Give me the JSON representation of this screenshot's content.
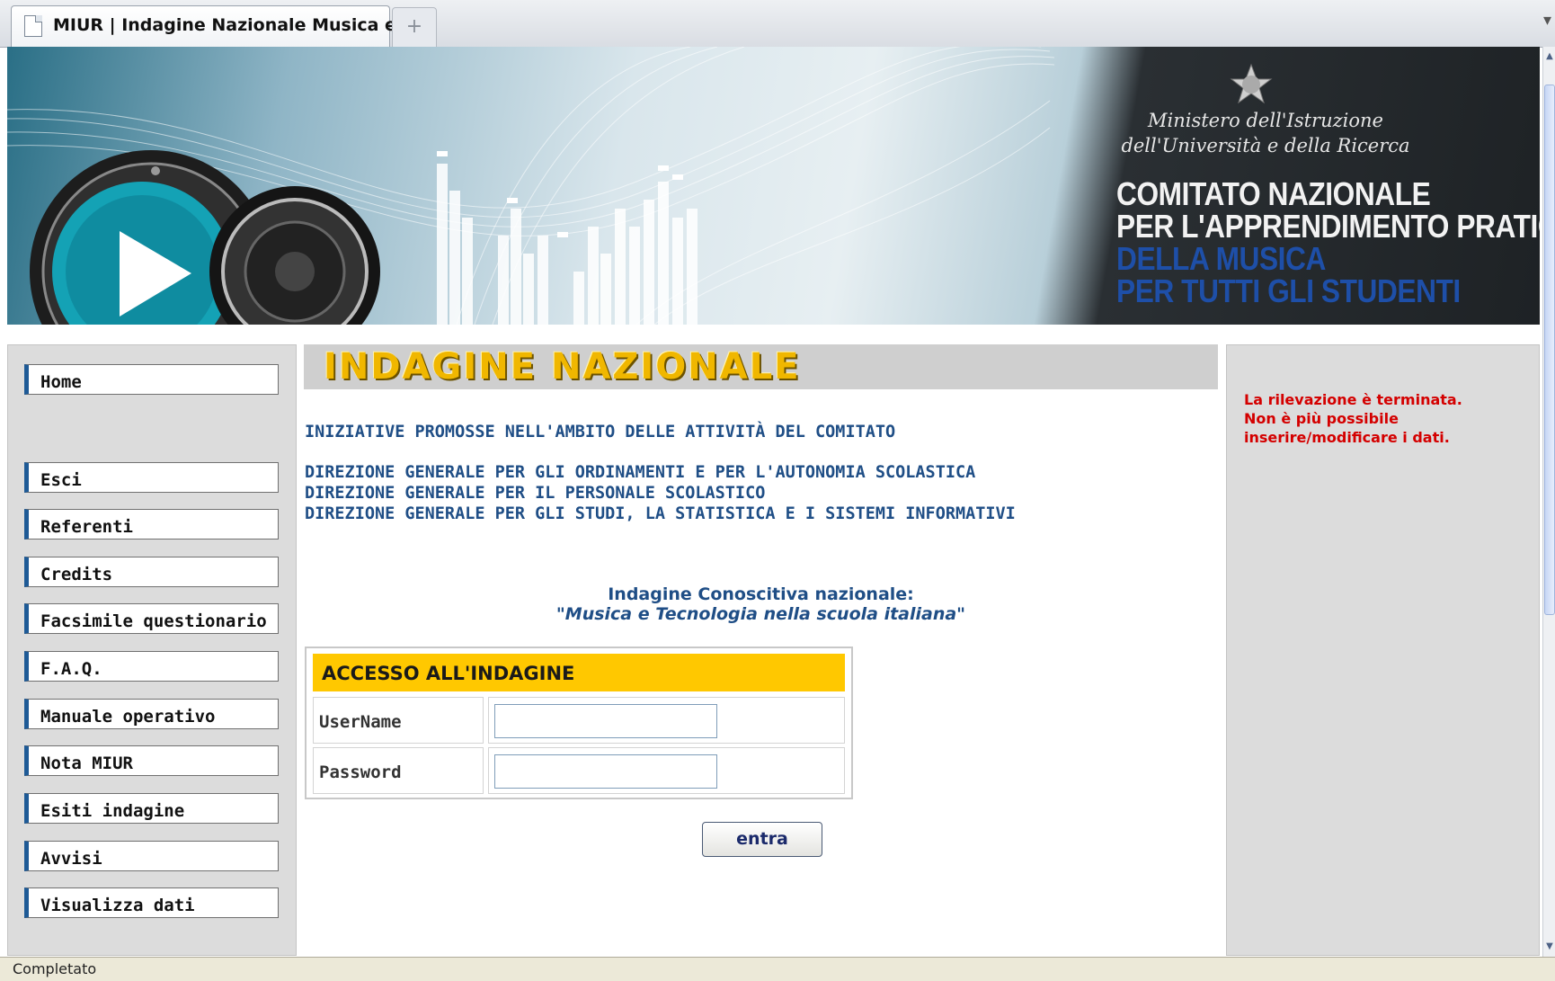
{
  "browser": {
    "tab_title": "MIUR | Indagine Nazionale Musica e ...",
    "new_tab": "+",
    "status": "Completato"
  },
  "banner": {
    "ministry_line1": "Ministero dell'Istruzione",
    "ministry_line2": "dell'Università e della Ricerca",
    "committee": [
      "COMITATO NAZIONALE",
      "PER L'APPRENDIMENTO PRATICO",
      "DELLA MUSICA",
      "PER TUTTI GLI STUDENTI"
    ]
  },
  "nav": {
    "items": [
      "Home",
      "Esci",
      "Referenti",
      "Credits",
      "Facsimile questionario",
      "F.A.Q.",
      "Manuale operativo",
      "Nota MIUR",
      "Esiti indagine",
      "Avvisi",
      "Visualizza dati"
    ]
  },
  "main": {
    "header": "INDAGINE NAZIONALE",
    "initiatives": "INIZIATIVE PROMOSSE NELL'AMBITO DELLE ATTIVITÀ DEL COMITATO",
    "directorates": [
      "DIREZIONE GENERALE PER GLI ORDINAMENTI E PER L'AUTONOMIA SCOLASTICA",
      "DIREZIONE GENERALE PER IL PERSONALE SCOLASTICO",
      "DIREZIONE GENERALE PER GLI STUDI, LA STATISTICA E I SISTEMI INFORMATIVI"
    ],
    "survey_title": "Indagine Conoscitiva nazionale:",
    "survey_subtitle": "\"Musica e Tecnologia nella scuola italiana\"",
    "login": {
      "heading": "ACCESSO ALL'INDAGINE",
      "username_label": "UserName",
      "password_label": "Password",
      "username_value": "",
      "password_value": "",
      "submit": "entra"
    }
  },
  "sidebar_right": {
    "notice": [
      "La rilevazione è terminata.",
      "Non è più possibile",
      "inserire/modificare i dati."
    ]
  },
  "colors": {
    "accent_yellow": "#ffc800",
    "title_blue": "#1f4e86",
    "notice_red": "#d40000",
    "nav_border": "#1e5a96"
  }
}
